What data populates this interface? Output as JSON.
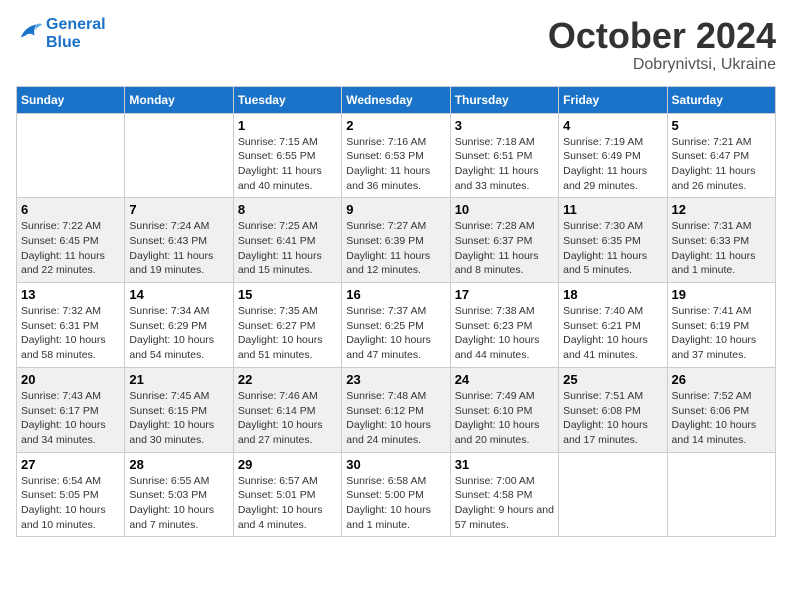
{
  "header": {
    "logo_line1": "General",
    "logo_line2": "Blue",
    "month": "October 2024",
    "location": "Dobrynivtsi, Ukraine"
  },
  "weekdays": [
    "Sunday",
    "Monday",
    "Tuesday",
    "Wednesday",
    "Thursday",
    "Friday",
    "Saturday"
  ],
  "weeks": [
    [
      {
        "day": "",
        "info": ""
      },
      {
        "day": "",
        "info": ""
      },
      {
        "day": "1",
        "info": "Sunrise: 7:15 AM\nSunset: 6:55 PM\nDaylight: 11 hours and 40 minutes."
      },
      {
        "day": "2",
        "info": "Sunrise: 7:16 AM\nSunset: 6:53 PM\nDaylight: 11 hours and 36 minutes."
      },
      {
        "day": "3",
        "info": "Sunrise: 7:18 AM\nSunset: 6:51 PM\nDaylight: 11 hours and 33 minutes."
      },
      {
        "day": "4",
        "info": "Sunrise: 7:19 AM\nSunset: 6:49 PM\nDaylight: 11 hours and 29 minutes."
      },
      {
        "day": "5",
        "info": "Sunrise: 7:21 AM\nSunset: 6:47 PM\nDaylight: 11 hours and 26 minutes."
      }
    ],
    [
      {
        "day": "6",
        "info": "Sunrise: 7:22 AM\nSunset: 6:45 PM\nDaylight: 11 hours and 22 minutes."
      },
      {
        "day": "7",
        "info": "Sunrise: 7:24 AM\nSunset: 6:43 PM\nDaylight: 11 hours and 19 minutes."
      },
      {
        "day": "8",
        "info": "Sunrise: 7:25 AM\nSunset: 6:41 PM\nDaylight: 11 hours and 15 minutes."
      },
      {
        "day": "9",
        "info": "Sunrise: 7:27 AM\nSunset: 6:39 PM\nDaylight: 11 hours and 12 minutes."
      },
      {
        "day": "10",
        "info": "Sunrise: 7:28 AM\nSunset: 6:37 PM\nDaylight: 11 hours and 8 minutes."
      },
      {
        "day": "11",
        "info": "Sunrise: 7:30 AM\nSunset: 6:35 PM\nDaylight: 11 hours and 5 minutes."
      },
      {
        "day": "12",
        "info": "Sunrise: 7:31 AM\nSunset: 6:33 PM\nDaylight: 11 hours and 1 minute."
      }
    ],
    [
      {
        "day": "13",
        "info": "Sunrise: 7:32 AM\nSunset: 6:31 PM\nDaylight: 10 hours and 58 minutes."
      },
      {
        "day": "14",
        "info": "Sunrise: 7:34 AM\nSunset: 6:29 PM\nDaylight: 10 hours and 54 minutes."
      },
      {
        "day": "15",
        "info": "Sunrise: 7:35 AM\nSunset: 6:27 PM\nDaylight: 10 hours and 51 minutes."
      },
      {
        "day": "16",
        "info": "Sunrise: 7:37 AM\nSunset: 6:25 PM\nDaylight: 10 hours and 47 minutes."
      },
      {
        "day": "17",
        "info": "Sunrise: 7:38 AM\nSunset: 6:23 PM\nDaylight: 10 hours and 44 minutes."
      },
      {
        "day": "18",
        "info": "Sunrise: 7:40 AM\nSunset: 6:21 PM\nDaylight: 10 hours and 41 minutes."
      },
      {
        "day": "19",
        "info": "Sunrise: 7:41 AM\nSunset: 6:19 PM\nDaylight: 10 hours and 37 minutes."
      }
    ],
    [
      {
        "day": "20",
        "info": "Sunrise: 7:43 AM\nSunset: 6:17 PM\nDaylight: 10 hours and 34 minutes."
      },
      {
        "day": "21",
        "info": "Sunrise: 7:45 AM\nSunset: 6:15 PM\nDaylight: 10 hours and 30 minutes."
      },
      {
        "day": "22",
        "info": "Sunrise: 7:46 AM\nSunset: 6:14 PM\nDaylight: 10 hours and 27 minutes."
      },
      {
        "day": "23",
        "info": "Sunrise: 7:48 AM\nSunset: 6:12 PM\nDaylight: 10 hours and 24 minutes."
      },
      {
        "day": "24",
        "info": "Sunrise: 7:49 AM\nSunset: 6:10 PM\nDaylight: 10 hours and 20 minutes."
      },
      {
        "day": "25",
        "info": "Sunrise: 7:51 AM\nSunset: 6:08 PM\nDaylight: 10 hours and 17 minutes."
      },
      {
        "day": "26",
        "info": "Sunrise: 7:52 AM\nSunset: 6:06 PM\nDaylight: 10 hours and 14 minutes."
      }
    ],
    [
      {
        "day": "27",
        "info": "Sunrise: 6:54 AM\nSunset: 5:05 PM\nDaylight: 10 hours and 10 minutes."
      },
      {
        "day": "28",
        "info": "Sunrise: 6:55 AM\nSunset: 5:03 PM\nDaylight: 10 hours and 7 minutes."
      },
      {
        "day": "29",
        "info": "Sunrise: 6:57 AM\nSunset: 5:01 PM\nDaylight: 10 hours and 4 minutes."
      },
      {
        "day": "30",
        "info": "Sunrise: 6:58 AM\nSunset: 5:00 PM\nDaylight: 10 hours and 1 minute."
      },
      {
        "day": "31",
        "info": "Sunrise: 7:00 AM\nSunset: 4:58 PM\nDaylight: 9 hours and 57 minutes."
      },
      {
        "day": "",
        "info": ""
      },
      {
        "day": "",
        "info": ""
      }
    ]
  ]
}
